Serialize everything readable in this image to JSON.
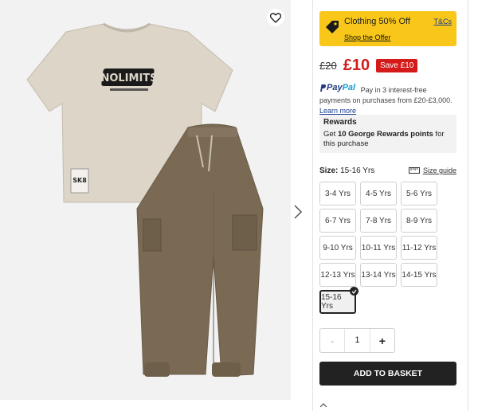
{
  "product_image": {
    "tshirt_print": "NOLIMITS",
    "patch_text": "SK8"
  },
  "promo": {
    "title": "Clothing 50% Off",
    "link": "Shop the Offer",
    "terms": "T&Cs"
  },
  "price": {
    "was": "£20",
    "now": "£10",
    "save": "Save  £10"
  },
  "paypal": {
    "logo_pay": "Pay",
    "logo_pal": "Pal",
    "text": "Pay in 3 interest-free payments on purchases from £20-£3,000.",
    "learn_more": "Learn more"
  },
  "rewards": {
    "title": "Rewards",
    "text_before": "Get ",
    "points": "10 George Rewards points",
    "text_after": " for this purchase"
  },
  "size": {
    "label": "Size:",
    "selected": "15-16 Yrs",
    "guide": "Size guide",
    "options": [
      "3-4 Yrs",
      "4-5 Yrs",
      "5-6 Yrs",
      "6-7 Yrs",
      "7-8 Yrs",
      "8-9 Yrs",
      "9-10 Yrs",
      "10-11 Yrs",
      "11-12 Yrs",
      "12-13 Yrs",
      "13-14 Yrs",
      "14-15 Yrs",
      "15-16 Yrs"
    ]
  },
  "quantity": {
    "minus": "-",
    "value": "1",
    "plus": "+"
  },
  "basket": {
    "label": "ADD TO BASKET"
  },
  "colors": {
    "promo_bg": "#f8c71a",
    "price_red": "#d51a1a",
    "basket_bg": "#222222",
    "link_blue": "#1a3d8f"
  }
}
